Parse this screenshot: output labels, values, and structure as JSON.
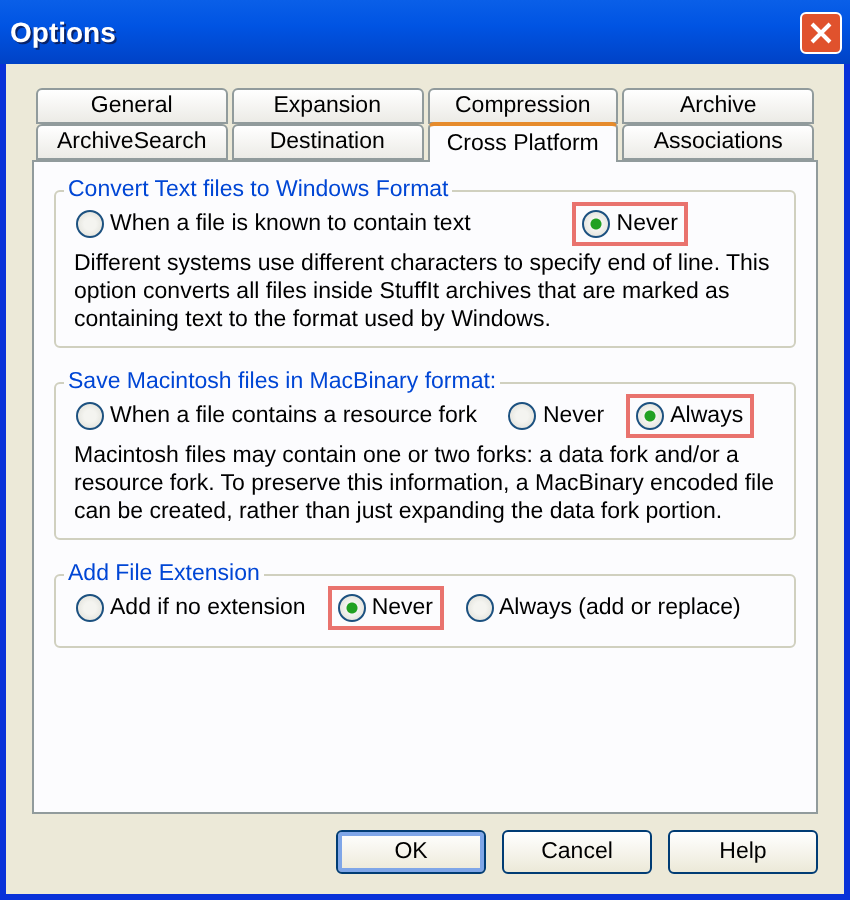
{
  "window": {
    "title": "Options"
  },
  "tab_rows": [
    [
      {
        "label": "General",
        "selected": false
      },
      {
        "label": "Expansion",
        "selected": false
      },
      {
        "label": "Compression",
        "selected": false
      },
      {
        "label": "Archive",
        "selected": false
      }
    ],
    [
      {
        "label": "ArchiveSearch",
        "selected": false
      },
      {
        "label": "Destination",
        "selected": false
      },
      {
        "label": "Cross Platform",
        "selected": true
      },
      {
        "label": "Associations",
        "selected": false
      }
    ]
  ],
  "groups": [
    {
      "legend": "Convert Text files to Windows Format",
      "options": [
        {
          "label": "When a file is known to contain text",
          "selected": false
        },
        {
          "label": "Never",
          "selected": true
        }
      ],
      "description": "Different systems use different characters to specify end of line.  This option converts all files inside StuffIt archives that are marked as containing text to the format used by Windows."
    },
    {
      "legend": "Save Macintosh files in MacBinary format:",
      "options": [
        {
          "label": "When a file contains a resource fork",
          "selected": false
        },
        {
          "label": "Never",
          "selected": false
        },
        {
          "label": "Always",
          "selected": true
        }
      ],
      "description": "Macintosh files may contain one or two forks: a data fork and/or a resource fork.  To preserve this information, a MacBinary encoded file can be created, rather than just expanding the data fork portion."
    },
    {
      "legend": "Add File Extension",
      "options": [
        {
          "label": "Add if no extension",
          "selected": false
        },
        {
          "label": "Never",
          "selected": true
        },
        {
          "label": "Always (add or replace)",
          "selected": false
        }
      ]
    }
  ],
  "buttons": [
    {
      "label": "OK",
      "default": true
    },
    {
      "label": "Cancel",
      "default": false
    },
    {
      "label": "Help",
      "default": false
    }
  ]
}
